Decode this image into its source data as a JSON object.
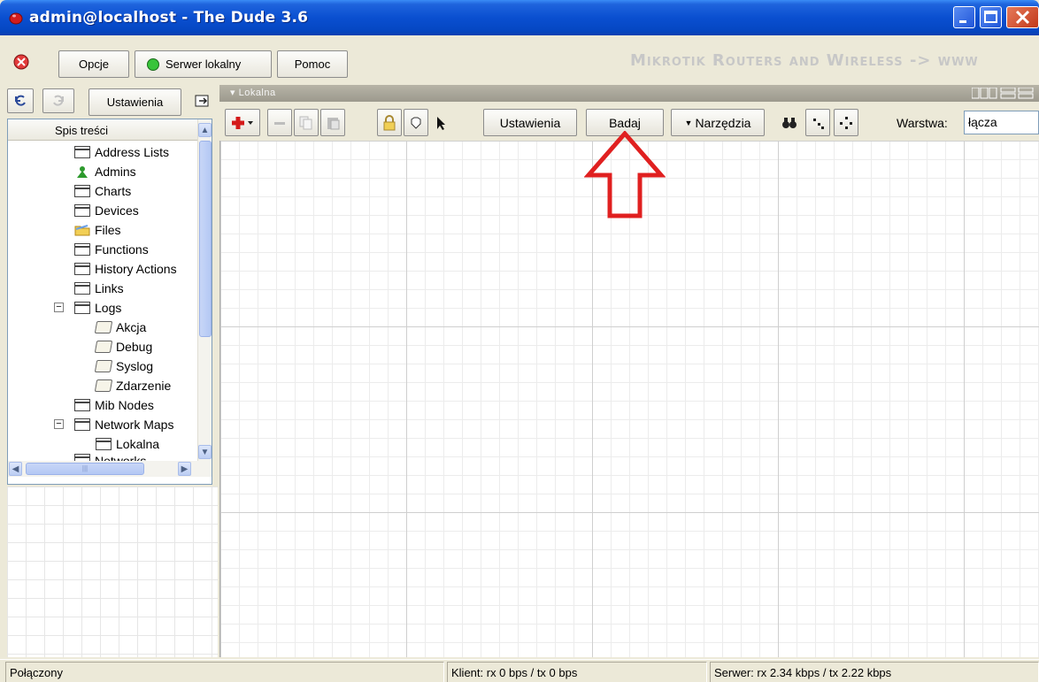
{
  "window": {
    "title": "admin@localhost - The Dude 3.6",
    "brand_text": "Mikrotik Routers and Wireless -> www"
  },
  "menu": {
    "options": "Opcje",
    "server": "Serwer lokalny",
    "help": "Pomoc"
  },
  "left_panel": {
    "settings": "Ustawienia",
    "tree_header": "Spis treści",
    "tree": {
      "address_lists": "Address Lists",
      "admins": "Admins",
      "charts": "Charts",
      "devices": "Devices",
      "files": "Files",
      "functions": "Functions",
      "history_actions": "History Actions",
      "links": "Links",
      "logs": "Logs",
      "log_action": "Akcja",
      "log_debug": "Debug",
      "log_syslog": "Syslog",
      "log_event": "Zdarzenie",
      "mib_nodes": "Mib Nodes",
      "network_maps": "Network Maps",
      "map_local": "Lokalna",
      "networks": "Networks"
    }
  },
  "map": {
    "tab_title": "Lokalna",
    "settings": "Ustawienia",
    "discover": "Badaj",
    "tools": "Narzędzia",
    "layer_label": "Warstwa:",
    "layer_value": "łącza"
  },
  "status": {
    "connection": "Połączony",
    "client": "Klient: rx 0 bps / tx 0 bps",
    "server": "Serwer: rx 2.34 kbps / tx 2.22 kbps"
  }
}
